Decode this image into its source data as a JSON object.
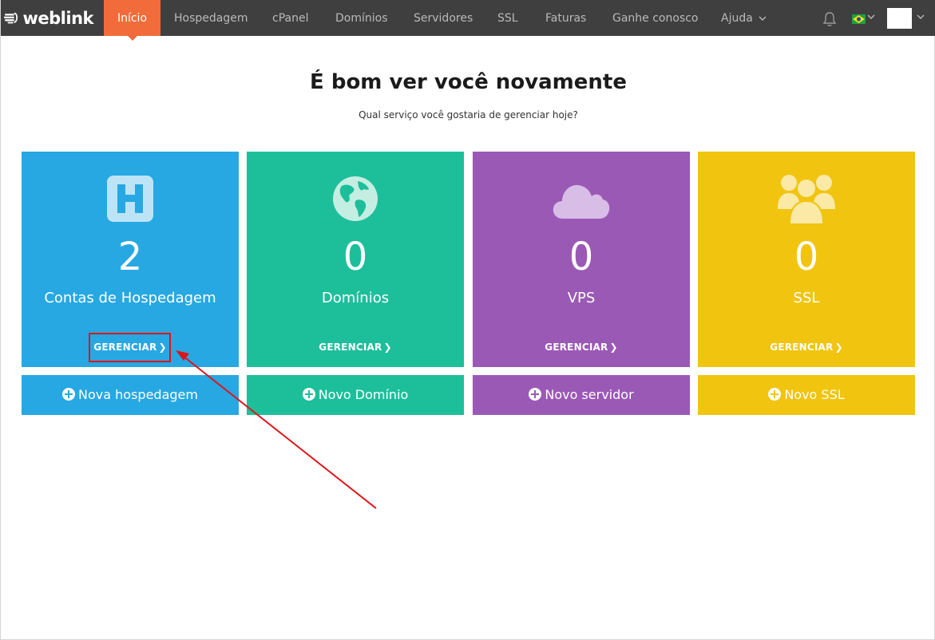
{
  "brand": {
    "name": "weblink"
  },
  "nav": {
    "items": [
      {
        "label": "Início",
        "active": true
      },
      {
        "label": "Hospedagem"
      },
      {
        "label": "cPanel"
      },
      {
        "label": "Domínios"
      },
      {
        "label": "Servidores"
      },
      {
        "label": "SSL"
      },
      {
        "label": "Faturas"
      },
      {
        "label": "Ganhe conosco"
      },
      {
        "label": "Ajuda",
        "has_dropdown": true
      }
    ],
    "icons": [
      "bell-icon",
      "brazil-flag-icon",
      "chevron-down-icon",
      "avatar"
    ]
  },
  "main": {
    "title": "É bom ver você novamente",
    "subtitle": "Qual serviço você gostaria de gerenciar hoje?"
  },
  "cards": [
    {
      "count": "2",
      "label": "Contas de Hospedagem",
      "manage": "GERENCIAR",
      "action": "Nova hospedagem",
      "color": "#27a8e2",
      "icon": "hosting-h-icon"
    },
    {
      "count": "0",
      "label": "Domínios",
      "manage": "GERENCIAR",
      "action": "Novo Domínio",
      "color": "#1dbf9b",
      "icon": "globe-icon"
    },
    {
      "count": "0",
      "label": "VPS",
      "manage": "GERENCIAR",
      "action": "Novo servidor",
      "color": "#9b59b6",
      "icon": "cloud-icon"
    },
    {
      "count": "0",
      "label": "SSL",
      "manage": "GERENCIAR",
      "action": "Novo SSL",
      "color": "#f1c40f",
      "icon": "users-icon"
    }
  ],
  "colors": {
    "topbar": "#3f3f3f",
    "active_tab": "#f26b3a",
    "annotation": "#e0141b"
  }
}
